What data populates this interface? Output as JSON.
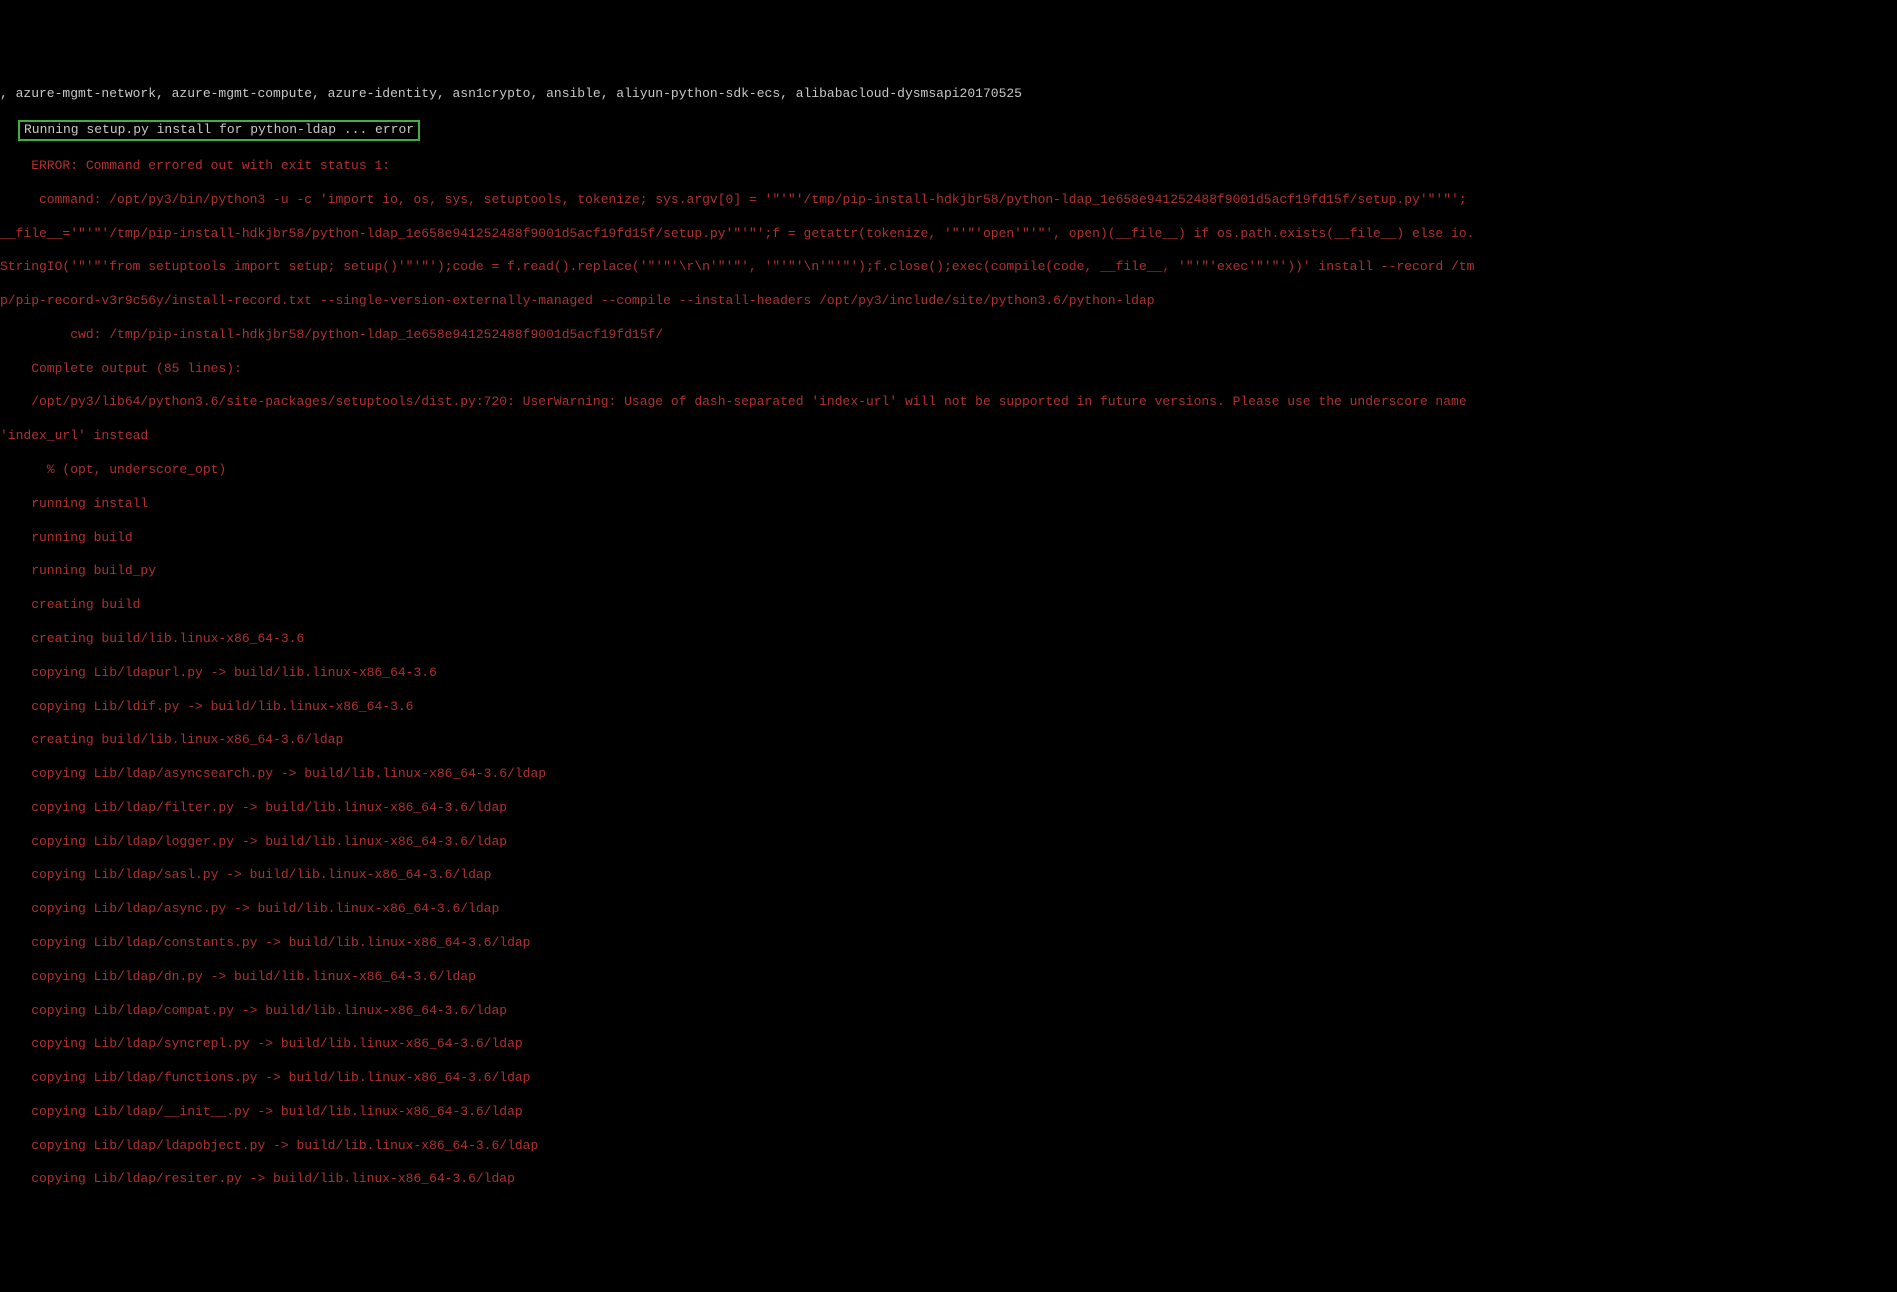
{
  "lines": {
    "top": ", azure-mgmt-network, azure-mgmt-compute, azure-identity, asn1crypto, ansible, aliyun-python-sdk-ecs, alibabacloud-dysmsapi20170525",
    "boxed": "Running setup.py install for python-ldap ... error",
    "l0": "    ERROR: Command errored out with exit status 1:",
    "l1": "     command: /opt/py3/bin/python3 -u -c 'import io, os, sys, setuptools, tokenize; sys.argv[0] = '\"'\"'/tmp/pip-install-hdkjbr58/python-ldap_1e658e941252488f9001d5acf19fd15f/setup.py'\"'\"';",
    "l2": "__file__='\"'\"'/tmp/pip-install-hdkjbr58/python-ldap_1e658e941252488f9001d5acf19fd15f/setup.py'\"'\"';f = getattr(tokenize, '\"'\"'open'\"'\"', open)(__file__) if os.path.exists(__file__) else io.",
    "l3": "StringIO('\"'\"'from setuptools import setup; setup()'\"'\"');code = f.read().replace('\"'\"'\\r\\n'\"'\"', '\"'\"'\\n'\"'\"');f.close();exec(compile(code, __file__, '\"'\"'exec'\"'\"'))' install --record /tm",
    "l4": "p/pip-record-v3r9c56y/install-record.txt --single-version-externally-managed --compile --install-headers /opt/py3/include/site/python3.6/python-ldap",
    "l5": "         cwd: /tmp/pip-install-hdkjbr58/python-ldap_1e658e941252488f9001d5acf19fd15f/",
    "l6": "    Complete output (85 lines):",
    "l7": "    /opt/py3/lib64/python3.6/site-packages/setuptools/dist.py:720: UserWarning: Usage of dash-separated 'index-url' will not be supported in future versions. Please use the underscore name ",
    "l8": "'index_url' instead",
    "l9": "      % (opt, underscore_opt)",
    "l10": "    running install",
    "l11": "    running build",
    "l12": "    running build_py",
    "l13": "    creating build",
    "l14": "    creating build/lib.linux-x86_64-3.6",
    "l15": "    copying Lib/ldapurl.py -> build/lib.linux-x86_64-3.6",
    "l16": "    copying Lib/ldif.py -> build/lib.linux-x86_64-3.6",
    "l17": "    creating build/lib.linux-x86_64-3.6/ldap",
    "l18": "    copying Lib/ldap/asyncsearch.py -> build/lib.linux-x86_64-3.6/ldap",
    "l19": "    copying Lib/ldap/filter.py -> build/lib.linux-x86_64-3.6/ldap",
    "l20": "    copying Lib/ldap/logger.py -> build/lib.linux-x86_64-3.6/ldap",
    "l21": "    copying Lib/ldap/sasl.py -> build/lib.linux-x86_64-3.6/ldap",
    "l22": "    copying Lib/ldap/async.py -> build/lib.linux-x86_64-3.6/ldap",
    "l23": "    copying Lib/ldap/constants.py -> build/lib.linux-x86_64-3.6/ldap",
    "l24": "    copying Lib/ldap/dn.py -> build/lib.linux-x86_64-3.6/ldap",
    "l25": "    copying Lib/ldap/compat.py -> build/lib.linux-x86_64-3.6/ldap",
    "l26": "    copying Lib/ldap/syncrepl.py -> build/lib.linux-x86_64-3.6/ldap",
    "l27": "    copying Lib/ldap/functions.py -> build/lib.linux-x86_64-3.6/ldap",
    "l28": "    copying Lib/ldap/__init__.py -> build/lib.linux-x86_64-3.6/ldap",
    "l29": "    copying Lib/ldap/ldapobject.py -> build/lib.linux-x86_64-3.6/ldap",
    "l30": "    copying Lib/ldap/resiter.py -> build/lib.linux-x86_64-3.6/ldap"
  }
}
